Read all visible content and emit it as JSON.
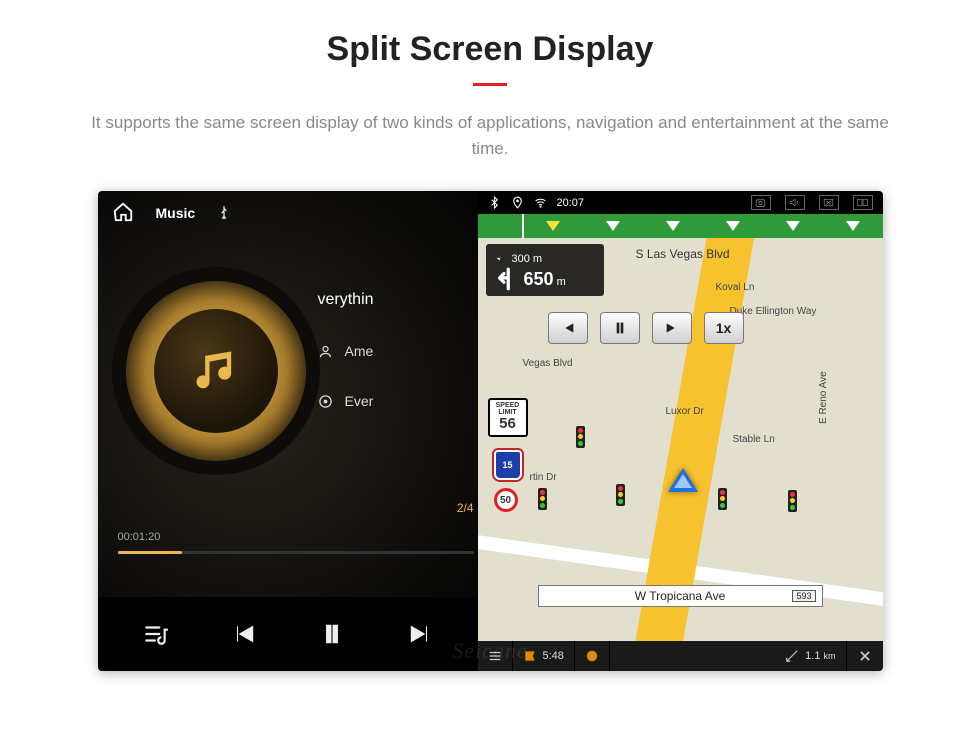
{
  "header": {
    "title": "Split Screen Display",
    "subtitle": "It supports the same screen display of two kinds of applications, navigation and entertainment at the same time."
  },
  "music": {
    "app_label": "Music",
    "now_playing_title_visible": "verythin",
    "rows": [
      {
        "label": "Ame"
      },
      {
        "label": "Ever"
      }
    ],
    "counter": "2/4",
    "elapsed": "00:01:20",
    "watermark": "Seicane"
  },
  "status": {
    "time": "20:07"
  },
  "nav": {
    "turn": {
      "distance_main": "650",
      "unit_main": "m",
      "distance_next": "300 m"
    },
    "speed": {
      "label_top": "SPEED",
      "label_mid": "LIMIT",
      "value": "56"
    },
    "shield_route": "15",
    "shield_alt": "50",
    "sim_speed": "1x",
    "streets": {
      "top": "S Las Vegas Blvd",
      "koval": "Koval Ln",
      "duke": "Duke Ellington Way",
      "luxor": "Luxor Dr",
      "stable": "Stable Ln",
      "reno": "E Reno Ave",
      "martin": "rtin Dr",
      "vegas2": "Vegas Blvd",
      "current": "W Tropicana Ave",
      "current_ref": "593"
    },
    "bottombar": {
      "eta": "5:48",
      "dist": "1.1",
      "dist_unit": "km"
    }
  }
}
